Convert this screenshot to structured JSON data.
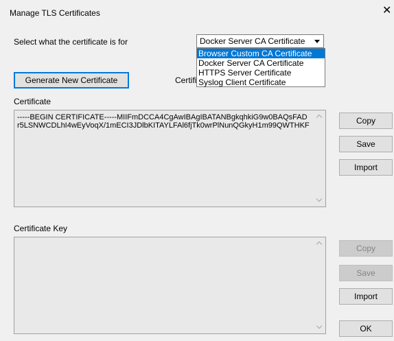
{
  "window": {
    "title": "Manage TLS Certificates",
    "close_glyph": "✕"
  },
  "purpose": {
    "label": "Select what the certificate is for",
    "selected": "Docker Server CA Certificate",
    "options": [
      "Browser Custom CA Certificate",
      "Docker Server CA Certificate",
      "HTTPS Server Certificate",
      "Syslog Client Certificate"
    ],
    "highlighted_option": "Browser Custom CA Certificate"
  },
  "generate_button": "Generate New Certificate",
  "partial_label": "Certific",
  "certificate": {
    "label": "Certificate",
    "lines": [
      "-----BEGIN CERTIFICATE-----MIIFmDCCA4CgAwIBAgIBATANBgkqhkiG9w0BAQsFAD",
      "r5LSNWCDLhI4wEyVoqX/1mECI3JDlbKITAYLFAl6fjTk0wrPlNunQGkyH1m99QWTHKF"
    ],
    "buttons": {
      "copy": "Copy",
      "save": "Save",
      "import": "Import"
    }
  },
  "key": {
    "label": "Certificate Key",
    "buttons": {
      "copy": "Copy",
      "save": "Save",
      "import": "Import"
    }
  },
  "ok_button": "OK",
  "colors": {
    "window_bg": "#f0f0f0",
    "accent": "#0078d7",
    "textarea_bg": "#e9e9e9",
    "button_bg": "#e1e1e1",
    "disabled_button_bg": "#cccccc"
  }
}
